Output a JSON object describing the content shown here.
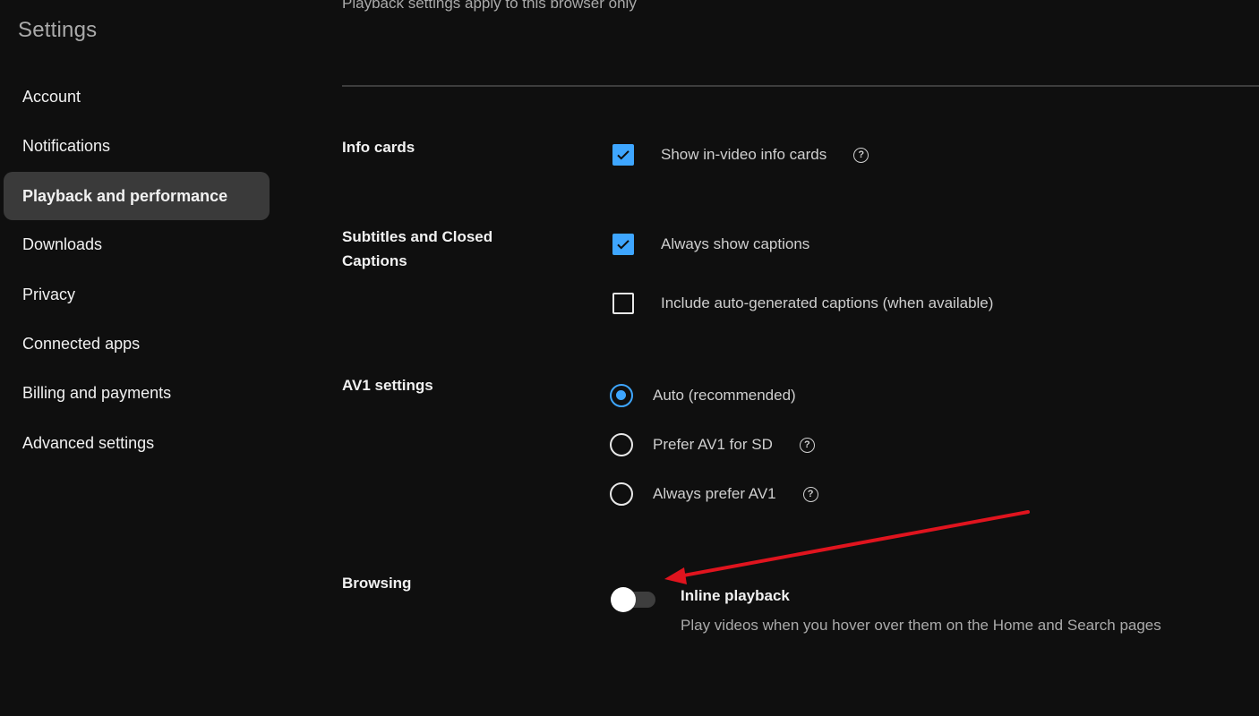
{
  "sidebar": {
    "title": "Settings",
    "items": [
      {
        "label": "Account",
        "active": false
      },
      {
        "label": "Notifications",
        "active": false
      },
      {
        "label": "Playback and performance",
        "active": true
      },
      {
        "label": "Downloads",
        "active": false
      },
      {
        "label": "Privacy",
        "active": false
      },
      {
        "label": "Connected apps",
        "active": false
      },
      {
        "label": "Billing and payments",
        "active": false
      },
      {
        "label": "Advanced settings",
        "active": false
      }
    ]
  },
  "main": {
    "subtitle": "Playback settings apply to this browser only",
    "sections": {
      "info_cards": {
        "label": "Info cards",
        "options": [
          {
            "label": "Show in-video info cards",
            "checked": true,
            "help_icon": "question-circle-icon"
          }
        ]
      },
      "captions": {
        "label": "Subtitles and Closed Captions",
        "options": [
          {
            "label": "Always show captions",
            "checked": true
          },
          {
            "label": "Include auto-generated captions (when available)",
            "checked": false
          }
        ]
      },
      "av1": {
        "label": "AV1 settings",
        "options": [
          {
            "label": "Auto (recommended)",
            "selected": true
          },
          {
            "label": "Prefer AV1 for SD",
            "selected": false,
            "help_icon": "question-circle-icon"
          },
          {
            "label": "Always prefer AV1",
            "selected": false,
            "help_icon": "question-circle-icon"
          }
        ]
      },
      "browsing": {
        "label": "Browsing",
        "toggle": {
          "title": "Inline playback",
          "description": "Play videos when you hover over them on the Home and Search pages",
          "on": false
        }
      }
    }
  },
  "colors": {
    "background": "#0f0f0f",
    "accent": "#3ea6ff",
    "sidebar_active": "#3a3a3a",
    "annotation_arrow": "#e0141e"
  },
  "help_glyph": "?"
}
